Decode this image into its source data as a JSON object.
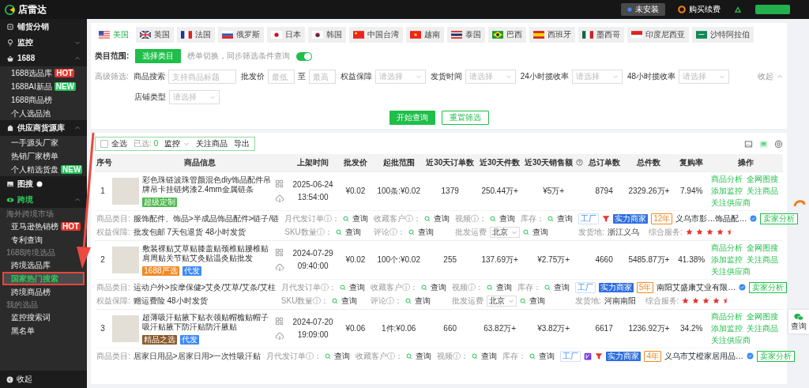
{
  "header": {
    "logo": "店雷达",
    "install": "未安装",
    "renew": "购买续费"
  },
  "sidebar": {
    "groups": [
      {
        "label": "铺货分销",
        "selected": false
      },
      {
        "label": "监控",
        "selected": false,
        "expanded": false
      },
      {
        "label": "1688",
        "selected": false,
        "expanded": true,
        "children": [
          {
            "label": "1688选品库",
            "badge": {
              "kind": "hot",
              "text": "HOT"
            },
            "selected": false
          },
          {
            "label": "1688AI新品",
            "badge": {
              "kind": "new",
              "text": "NEW"
            },
            "selected": false
          },
          {
            "label": "1688商品榜",
            "selected": false
          },
          {
            "label": "个人选品池",
            "selected": false
          }
        ]
      },
      {
        "label": "供应商货源库",
        "selected": false,
        "expanded": true,
        "children": [
          {
            "label": "一手源头厂家",
            "selected": false
          },
          {
            "label": "热销厂家榜单",
            "selected": false
          },
          {
            "label": "个人精选货盘",
            "badge": {
              "kind": "new",
              "text": "NEW"
            },
            "selected": false
          }
        ]
      },
      {
        "label": "图搜",
        "selected": false,
        "info": true
      },
      {
        "label": "跨境",
        "selected": true,
        "expanded": true,
        "children": [
          {
            "kind": "section",
            "label": "海外跨境市场"
          },
          {
            "label": "亚马逊热销榜",
            "badge": {
              "kind": "hot",
              "text": "HOT"
            },
            "selected": false
          },
          {
            "label": "专利查询",
            "selected": false
          },
          {
            "kind": "section",
            "label": "1688跨境选品"
          },
          {
            "label": "跨境选品库",
            "selected": false
          },
          {
            "label": "国家热门搜索",
            "selected": true,
            "highlighted": true
          },
          {
            "label": "跨境商品榜",
            "selected": false
          },
          {
            "kind": "section",
            "label": "我的选品"
          },
          {
            "label": "监控搜索词",
            "selected": false
          },
          {
            "label": "黑名单",
            "selected": false
          }
        ]
      }
    ],
    "collapse": "收起"
  },
  "annotation_arrow": true,
  "tabs": [
    {
      "kind": "us",
      "label": "美国",
      "selected": true
    },
    {
      "kind": "gb",
      "label": "英国",
      "selected": false
    },
    {
      "kind": "fr",
      "label": "法国",
      "selected": false
    },
    {
      "kind": "ru",
      "label": "俄罗斯",
      "selected": false
    },
    {
      "kind": "jp",
      "label": "日本",
      "selected": false
    },
    {
      "kind": "kr",
      "label": "韩国",
      "selected": false
    },
    {
      "kind": "cn",
      "label": "中国台湾",
      "selected": false
    },
    {
      "kind": "vn",
      "label": "越南",
      "selected": false
    },
    {
      "kind": "th",
      "label": "泰国",
      "selected": false
    },
    {
      "kind": "br",
      "label": "巴西",
      "selected": false
    },
    {
      "kind": "es",
      "label": "西班牙",
      "selected": false
    },
    {
      "kind": "mx",
      "label": "墨西哥",
      "selected": false
    },
    {
      "kind": "id",
      "label": "印度尼西亚",
      "selected": false
    },
    {
      "kind": "sa",
      "label": "沙特阿拉伯",
      "selected": false
    }
  ],
  "filters": {
    "scope_label": "类目范围:",
    "scope_button": "选择类目",
    "sync_hint": "榜单切换，同步筛选条件查询",
    "sync_on": true,
    "advanced_label": "高级筛选:",
    "collapse": "收起",
    "rows": [
      [
        {
          "kind": "text",
          "label": "商品搜索",
          "placeholder": "支持商品标题"
        },
        {
          "kind": "range",
          "label": "批发价",
          "min_placeholder": "最低",
          "separator": "至",
          "max_placeholder": "最高"
        },
        {
          "kind": "select",
          "label": "权益保障",
          "placeholder": "请选择"
        },
        {
          "kind": "select",
          "label": "发货时间",
          "placeholder": "请选择"
        },
        {
          "kind": "select",
          "label": "24小时揽收率",
          "placeholder": "请选择"
        },
        {
          "kind": "select",
          "label": "48小时揽收率",
          "placeholder": "请选择"
        }
      ],
      [
        {
          "kind": "select",
          "label": "店铺类型",
          "placeholder": "请选择"
        }
      ]
    ],
    "buttons": [
      {
        "kind": "primary",
        "label": "开始查询"
      },
      {
        "kind": "outline",
        "label": "重置筛选"
      }
    ]
  },
  "toolbar": {
    "select_all": "全选",
    "checked": false,
    "selected_label": "已选:",
    "selected_count": "0",
    "monitor": "监控",
    "follow": "关注商品",
    "export": "导出",
    "views": [
      {
        "kind": "image",
        "selected": false
      },
      {
        "kind": "list",
        "selected": true
      }
    ]
  },
  "table": {
    "columns": [
      {
        "label": "序号"
      },
      {
        "label": "商品信息"
      },
      {
        "label": "上架时间"
      },
      {
        "label": "批发价"
      },
      {
        "label": "起批范围"
      },
      {
        "label": "近30天订单数"
      },
      {
        "label": "近30天件数"
      },
      {
        "label": "近30天销售额",
        "help": true
      },
      {
        "label": "总订单数"
      },
      {
        "label": "总件数"
      },
      {
        "label": "复购率"
      },
      {
        "label": "操作"
      }
    ],
    "rows": [
      {
        "index": "1",
        "title": "彩色珠链波珠管颜混色diy饰品配件吊牌吊卡挂链烤漆2.4mm金属链条",
        "tags": [
          {
            "text": "超级定制",
            "color": "#4cb94c"
          }
        ],
        "date": "2025-06-24",
        "time": "13:54:00",
        "price": "¥0.02",
        "moq": "100条:¥0.02",
        "orders_30d": "1379",
        "pieces_30d": "250.44万+",
        "sales_30d": "¥5万+",
        "orders_total": "8794",
        "pieces_total": "2329.26万+",
        "repurchase": "7.94%",
        "actions": [
          "商品分析",
          "全网图搜",
          "添加监控",
          "关注商品",
          "关注供应商"
        ],
        "line1": [
          {
            "kind": "field",
            "label": "商品类目:",
            "value": "服饰配件、饰品>半成品饰品配件>链子/链"
          },
          {
            "kind": "query",
            "label": "月代发订单ⓘ：",
            "action": "查询"
          },
          {
            "kind": "query",
            "label": "收藏客户ⓘ：",
            "action": "查询"
          },
          {
            "kind": "query",
            "label": "视频ⓘ：",
            "action": "查询"
          },
          {
            "kind": "query",
            "label": "库存：",
            "action": "查询"
          },
          {
            "kind": "seller",
            "badges": [
              {
                "kind": "factory",
                "text": "工厂"
              },
              {
                "kind": "red-logo"
              },
              {
                "kind": "strength",
                "text": "实力商家"
              },
              {
                "kind": "years",
                "text": "12年"
              }
            ],
            "supplier": "义乌市影…饰品配…",
            "verified": true,
            "button": "卖家分析"
          }
        ],
        "line2": [
          {
            "kind": "field",
            "label": "权益保障:",
            "value": "批发包邮  7天包退货  48小时发货"
          },
          {
            "kind": "query",
            "label": "SKU数量ⓘ：",
            "action": "查询"
          },
          {
            "kind": "query",
            "label": "评论ⓘ：",
            "action": "查询"
          },
          {
            "kind": "freight",
            "label": "批发运费",
            "value": "北京",
            "action": "查询"
          },
          {
            "kind": "origin",
            "label": "发货地:",
            "value": "浙江义乌",
            "rating_label": "综合服务:",
            "stars": 4.5
          }
        ]
      },
      {
        "index": "2",
        "title": "敷装裸贴艾草贴膝盖贴颈椎贴腰椎贴肩周贴关节贴艾灸贴温灸贴批发",
        "tags": [
          {
            "text": "1688严选",
            "color": "#f08a24"
          },
          {
            "text": "代发",
            "color": "#3d8af7"
          }
        ],
        "date": "2024-07-29",
        "time": "09:40:00",
        "price": "¥0.02",
        "moq": "100个:¥0.02",
        "orders_30d": "255",
        "pieces_30d": "137.69万+",
        "sales_30d": "¥2.75万+",
        "orders_total": "4660",
        "pieces_total": "5485.87万+",
        "repurchase": "41.38%",
        "actions": [
          "商品分析",
          "全网图搜",
          "添加监控",
          "关注商品",
          "关注供应商"
        ],
        "line1": [
          {
            "kind": "field",
            "label": "商品类目:",
            "value": "运动户外>按摩保健>艾灸/艾草/艾条/艾柱"
          },
          {
            "kind": "query",
            "label": "月代发订单ⓘ：",
            "action": "查询"
          },
          {
            "kind": "query",
            "label": "收藏客户ⓘ：",
            "action": "查询"
          },
          {
            "kind": "query",
            "label": "视频ⓘ：",
            "action": "查询"
          },
          {
            "kind": "query",
            "label": "库存：",
            "action": "查询"
          },
          {
            "kind": "seller",
            "badges": [
              {
                "kind": "factory",
                "text": "工厂"
              },
              {
                "kind": "strength",
                "text": "实力商家"
              },
              {
                "kind": "years",
                "text": "5年"
              }
            ],
            "supplier": "南阳艾盛康艾业有限…",
            "verified": true,
            "button": "卖家分析"
          }
        ],
        "line2": [
          {
            "kind": "field",
            "label": "权益保障:",
            "value": "赠运费险  48小时发货"
          },
          {
            "kind": "query",
            "label": "SKU数量ⓘ：",
            "action": "查询"
          },
          {
            "kind": "query",
            "label": "评论ⓘ：",
            "action": "查询"
          },
          {
            "kind": "freight",
            "label": "批发运费",
            "value": "北京",
            "action": "查询"
          },
          {
            "kind": "origin",
            "label": "发货地:",
            "value": "河南南阳",
            "rating_label": "综合服务:",
            "stars": 4.5
          }
        ]
      },
      {
        "index": "3",
        "title": "超薄吸汗贴腋下贴衣领贴帽檐贴帽子吸汗贴腋下防汗贴防汗腋贴",
        "tags": [
          {
            "text": "精品之选",
            "color": "#8a5a2b"
          },
          {
            "text": "代发",
            "color": "#3d8af7"
          }
        ],
        "date": "2024-07-20",
        "time": "19:09:00",
        "price": "¥0.06",
        "moq": "1件:¥0.06",
        "orders_30d": "660",
        "pieces_30d": "63.82万+",
        "sales_30d": "¥3.82万+",
        "orders_total": "6617",
        "pieces_total": "1236.92万+",
        "repurchase": "34.2%",
        "actions": [
          "商品分析",
          "全网图搜",
          "添加监控",
          "关注商品",
          "关注供应商"
        ],
        "line1": [
          {
            "kind": "field",
            "label": "商品类目:",
            "value": "居家日用品>居家日用>一次性吸汗贴"
          },
          {
            "kind": "query",
            "label": "月代发订单ⓘ：",
            "action": "查询"
          },
          {
            "kind": "query",
            "label": "收藏客户ⓘ：",
            "action": "查询"
          },
          {
            "kind": "query",
            "label": "视频ⓘ：",
            "action": "查询"
          },
          {
            "kind": "query",
            "label": "库存：",
            "action": "查询"
          },
          {
            "kind": "seller",
            "badges": [
              {
                "kind": "factory",
                "text": "工厂"
              },
              {
                "kind": "purple-logo"
              },
              {
                "kind": "red-logo"
              },
              {
                "kind": "strength",
                "text": "实力商家"
              },
              {
                "kind": "years",
                "text": "4年"
              }
            ],
            "supplier": "义乌市艾橙家居用品…",
            "verified": true,
            "button": "卖家分析"
          }
        ]
      }
    ]
  },
  "chat_widget": {
    "label": "查询"
  }
}
